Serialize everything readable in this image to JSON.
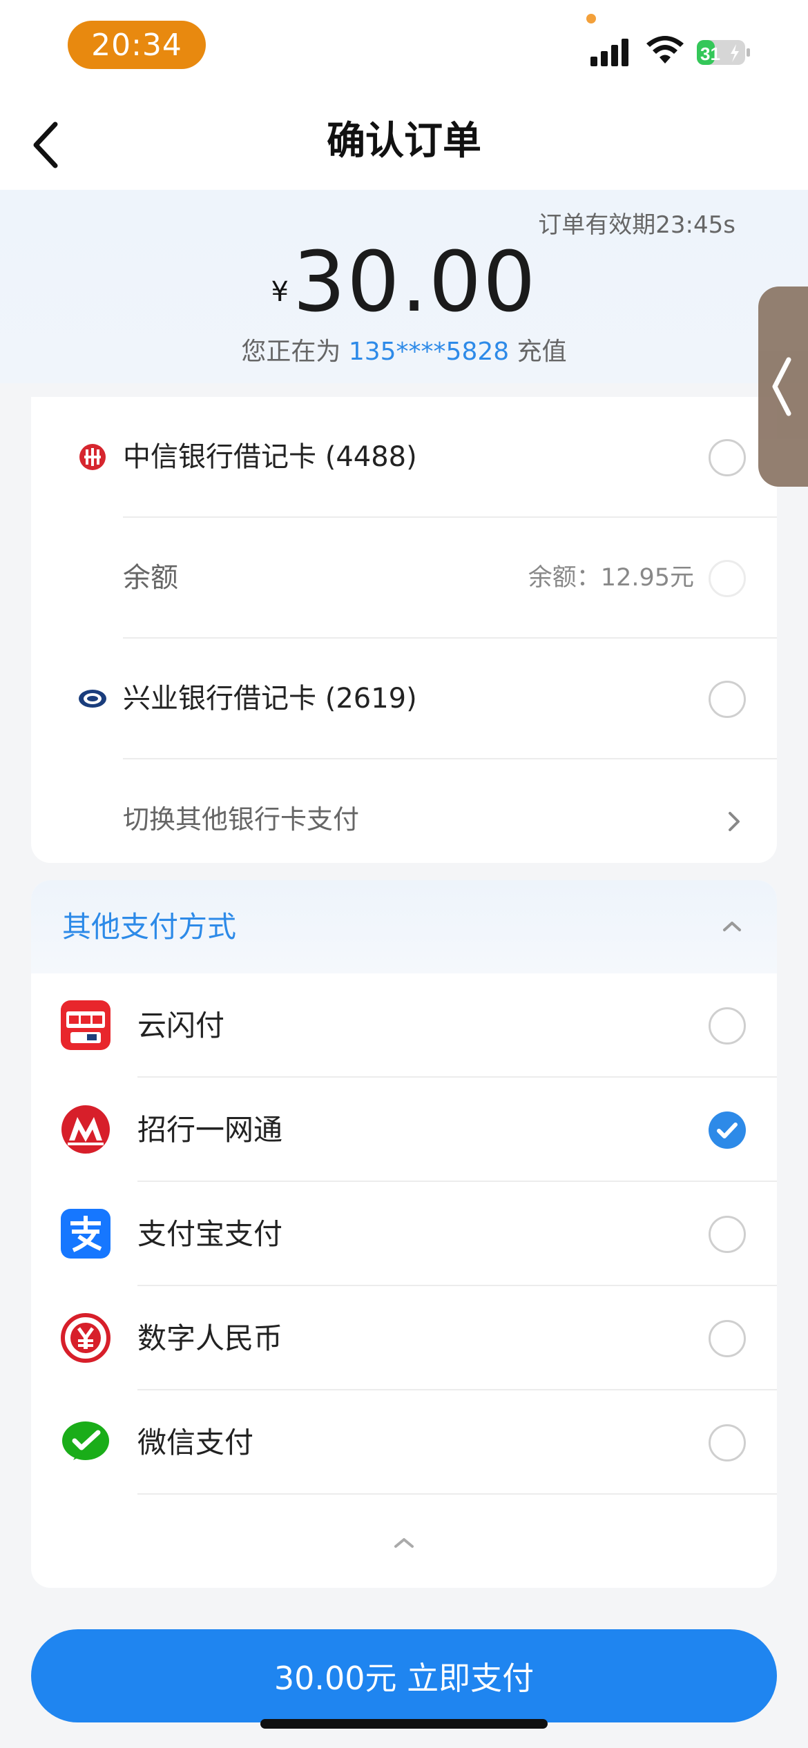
{
  "status_bar": {
    "time": "20:34",
    "battery": "31"
  },
  "nav": {
    "title": "确认订单"
  },
  "order": {
    "expire_text": "订单有效期23:45s",
    "currency": "¥",
    "amount": "30.00",
    "recharge_prefix": "您正在为 ",
    "phone": "135****5828",
    "recharge_suffix": " 充值"
  },
  "bank_cards": [
    {
      "label": "中信银行借记卡 (4488)",
      "icon": "citic-bank-icon"
    },
    {
      "label": "余额",
      "value": "余额：12.95元"
    },
    {
      "label": "兴业银行借记卡 (2619)",
      "icon": "cib-bank-icon"
    },
    {
      "label": "切换其他银行卡支付"
    }
  ],
  "other_payments": {
    "title": "其他支付方式",
    "items": [
      {
        "label": "云闪付",
        "icon": "unionpay-quickpass-icon",
        "checked": false
      },
      {
        "label": "招行一网通",
        "icon": "cmb-icon",
        "checked": true
      },
      {
        "label": "支付宝支付",
        "icon": "alipay-icon",
        "checked": false
      },
      {
        "label": "数字人民币",
        "icon": "ecny-icon",
        "checked": false
      },
      {
        "label": "微信支付",
        "icon": "wechat-pay-icon",
        "checked": false
      }
    ]
  },
  "pay_button": {
    "label": "30.00元 立即支付"
  },
  "colors": {
    "accent": "#2d8ae8",
    "button": "#1f85f0",
    "time_pill": "#e8890f"
  }
}
